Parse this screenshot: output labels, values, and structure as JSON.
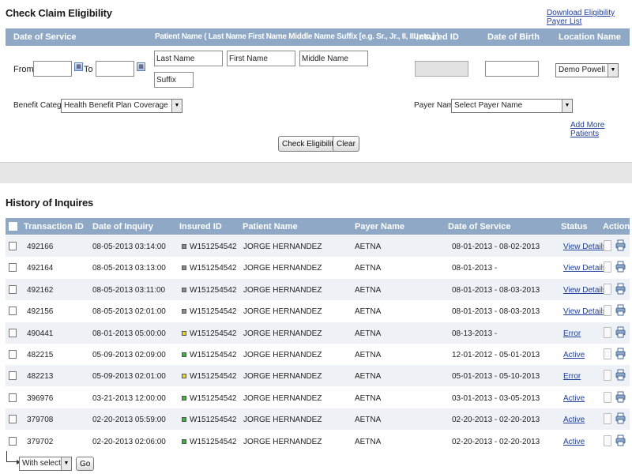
{
  "check": {
    "title": "Check Claim Eligibility",
    "download_link": "Download Eligibility Payer List",
    "headers": {
      "date_of_service": "Date of Service",
      "patient_name": "Patient Name ( Last Name First Name Middle Name Suffix [e.g. Sr., Jr., II, III, etc.] )",
      "insured_id": "Insured ID",
      "date_of_birth": "Date of Birth",
      "location_name": "Location Name"
    },
    "from_label": "From -",
    "to_label": "To -",
    "last_name_value": "Last Name",
    "first_name_value": "First Name",
    "middle_name_value": "Middle Name",
    "suffix_value": "Suffix",
    "location_value": "Demo Powell Care",
    "benefit_label": "Benefit Category :",
    "benefit_value": "Health Benefit Plan Coverage",
    "payer_label": "Payer Name :",
    "payer_value": "Select Payer Name",
    "add_more": "Add More Patients",
    "check_button": "Check Eligibility",
    "clear_button": "Clear"
  },
  "history": {
    "title": "History of Inquires",
    "columns": {
      "transaction_id": "Transaction ID",
      "date_of_inquiry": "Date of Inquiry",
      "insured_id": "Insured ID",
      "patient_name": "Patient Name",
      "payer_name": "Payer Name",
      "date_of_service": "Date of Service",
      "status": "Status",
      "actions": "Actions"
    },
    "rows": [
      {
        "id": "492166",
        "inquiry": "08-05-2013 03:14:00",
        "insured": "W151254542",
        "patient": "JORGE HERNANDEZ",
        "payer": "AETNA",
        "service": "08-01-2013 - 08-02-2013",
        "status": "View Details",
        "dot": "#8a8a8a"
      },
      {
        "id": "492164",
        "inquiry": "08-05-2013 03:13:00",
        "insured": "W151254542",
        "patient": "JORGE HERNANDEZ",
        "payer": "AETNA",
        "service": "08-01-2013 -",
        "status": "View Details",
        "dot": "#8a8a8a"
      },
      {
        "id": "492162",
        "inquiry": "08-05-2013 03:11:00",
        "insured": "W151254542",
        "patient": "JORGE HERNANDEZ",
        "payer": "AETNA",
        "service": "08-01-2013 - 08-03-2013",
        "status": "View Details",
        "dot": "#8a8a8a"
      },
      {
        "id": "492156",
        "inquiry": "08-05-2013 02:01:00",
        "insured": "W151254542",
        "patient": "JORGE HERNANDEZ",
        "payer": "AETNA",
        "service": "08-01-2013 - 08-03-2013",
        "status": "View Details",
        "dot": "#8a8a8a"
      },
      {
        "id": "490441",
        "inquiry": "08-01-2013 05:00:00",
        "insured": "W151254542",
        "patient": "JORGE HERNANDEZ",
        "payer": "AETNA",
        "service": "08-13-2013 -",
        "status": "Error",
        "dot": "#e6d23a"
      },
      {
        "id": "482215",
        "inquiry": "05-09-2013 02:09:00",
        "insured": "W151254542",
        "patient": "JORGE HERNANDEZ",
        "payer": "AETNA",
        "service": "12-01-2012 - 05-01-2013",
        "status": "Active",
        "dot": "#3ab53a"
      },
      {
        "id": "482213",
        "inquiry": "05-09-2013 02:01:00",
        "insured": "W151254542",
        "patient": "JORGE HERNANDEZ",
        "payer": "AETNA",
        "service": "05-01-2013 - 05-10-2013",
        "status": "Error",
        "dot": "#e6d23a"
      },
      {
        "id": "396976",
        "inquiry": "03-21-2013 12:00:00",
        "insured": "W151254542",
        "patient": "JORGE HERNANDEZ",
        "payer": "AETNA",
        "service": "03-01-2013 - 03-05-2013",
        "status": "Active",
        "dot": "#3ab53a"
      },
      {
        "id": "379708",
        "inquiry": "02-20-2013 05:59:00",
        "insured": "W151254542",
        "patient": "JORGE HERNANDEZ",
        "payer": "AETNA",
        "service": "02-20-2013 - 02-20-2013",
        "status": "Active",
        "dot": "#3ab53a"
      },
      {
        "id": "379702",
        "inquiry": "02-20-2013 02:06:00",
        "insured": "W151254542",
        "patient": "JORGE HERNANDEZ",
        "payer": "AETNA",
        "service": "02-20-2013 - 02-20-2013",
        "status": "Active",
        "dot": "#3ab53a"
      }
    ],
    "with_selected": "With selected:",
    "go_button": "Go"
  },
  "colors": {
    "header_bar": "#8ea8c6",
    "link": "#1f3f9b",
    "row_alt": "#eef2f7"
  }
}
